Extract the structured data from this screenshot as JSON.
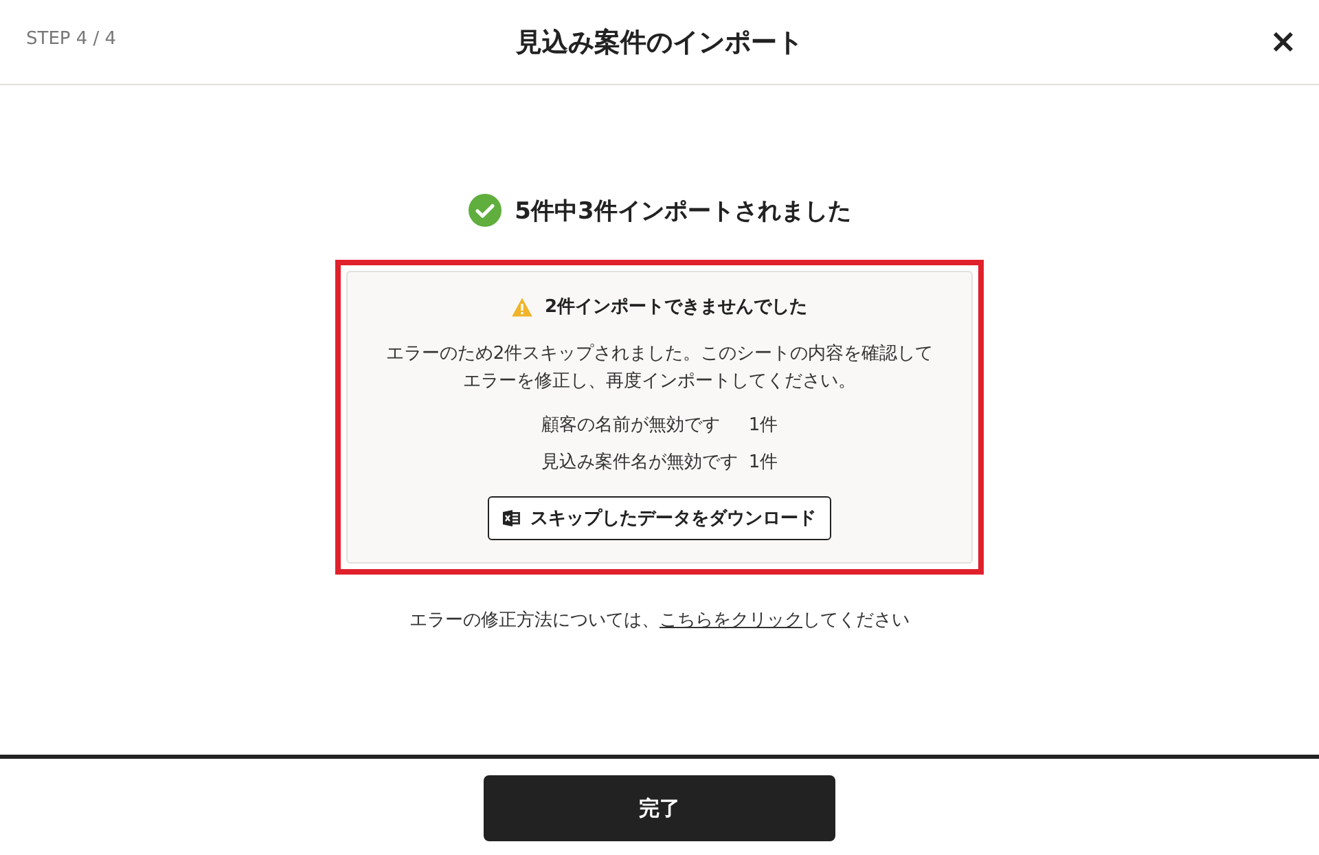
{
  "header": {
    "step": "STEP 4 / 4",
    "title": "見込み案件のインポート",
    "close": "×"
  },
  "result": {
    "title": "5件中3件インポートされました"
  },
  "warning": {
    "title": "2件インポートできませんでした",
    "message_lines": [
      "エラーのため2件スキップされました。このシートの内容を確認して",
      "エラーを修正し、再度インポートしてください。"
    ],
    "errors": [
      {
        "label": "顧客の名前が無効です",
        "count": "1件"
      },
      {
        "label": "見込み案件名が無効です",
        "count": "1件"
      }
    ],
    "download_button": "スキップしたデータをダウンロード"
  },
  "help": {
    "before": "エラーの修正方法については、",
    "link": "こちらをクリック",
    "after": "してください"
  },
  "footer": {
    "button": "完了"
  }
}
